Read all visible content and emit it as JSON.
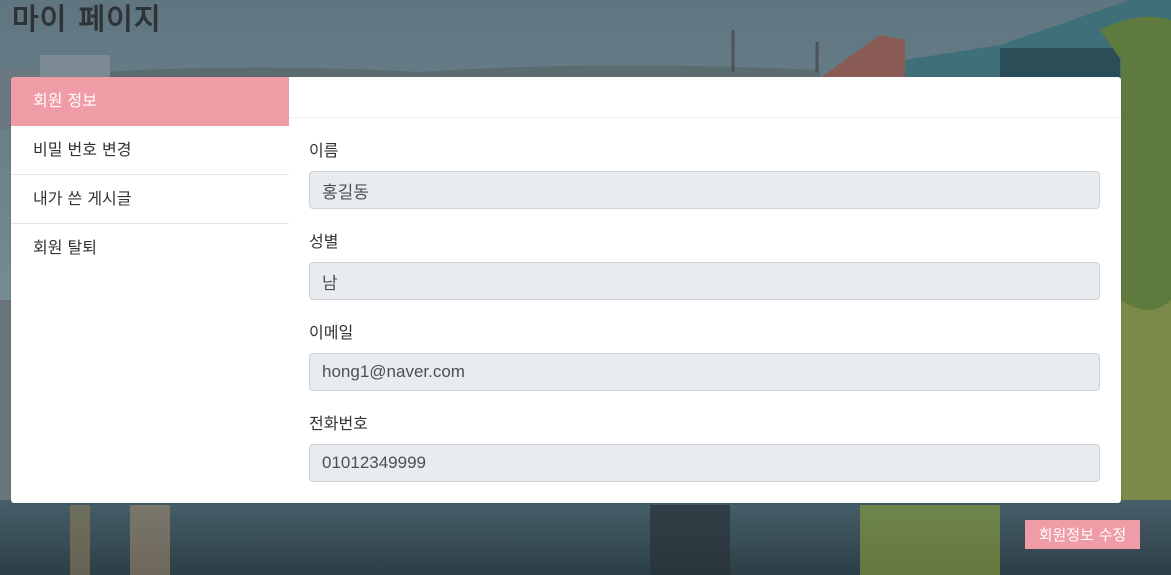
{
  "page": {
    "title": "마이 페이지"
  },
  "sidebar": {
    "items": [
      {
        "label": "회원 정보",
        "active": true
      },
      {
        "label": "비밀 번호 변경",
        "active": false
      },
      {
        "label": "내가 쓴 게시글",
        "active": false
      },
      {
        "label": "회원 탈퇴",
        "active": false
      }
    ]
  },
  "form": {
    "name": {
      "label": "이름",
      "value": "홍길동"
    },
    "gender": {
      "label": "성별",
      "value": "남"
    },
    "email": {
      "label": "이메일",
      "value": "hong1@naver.com"
    },
    "phone": {
      "label": "전화번호",
      "value": "01012349999"
    }
  },
  "actions": {
    "edit_label": "회원정보 수정"
  },
  "colors": {
    "accent": "#f09ca6",
    "input_bg": "#e9ecef",
    "title": "#2e3335"
  }
}
